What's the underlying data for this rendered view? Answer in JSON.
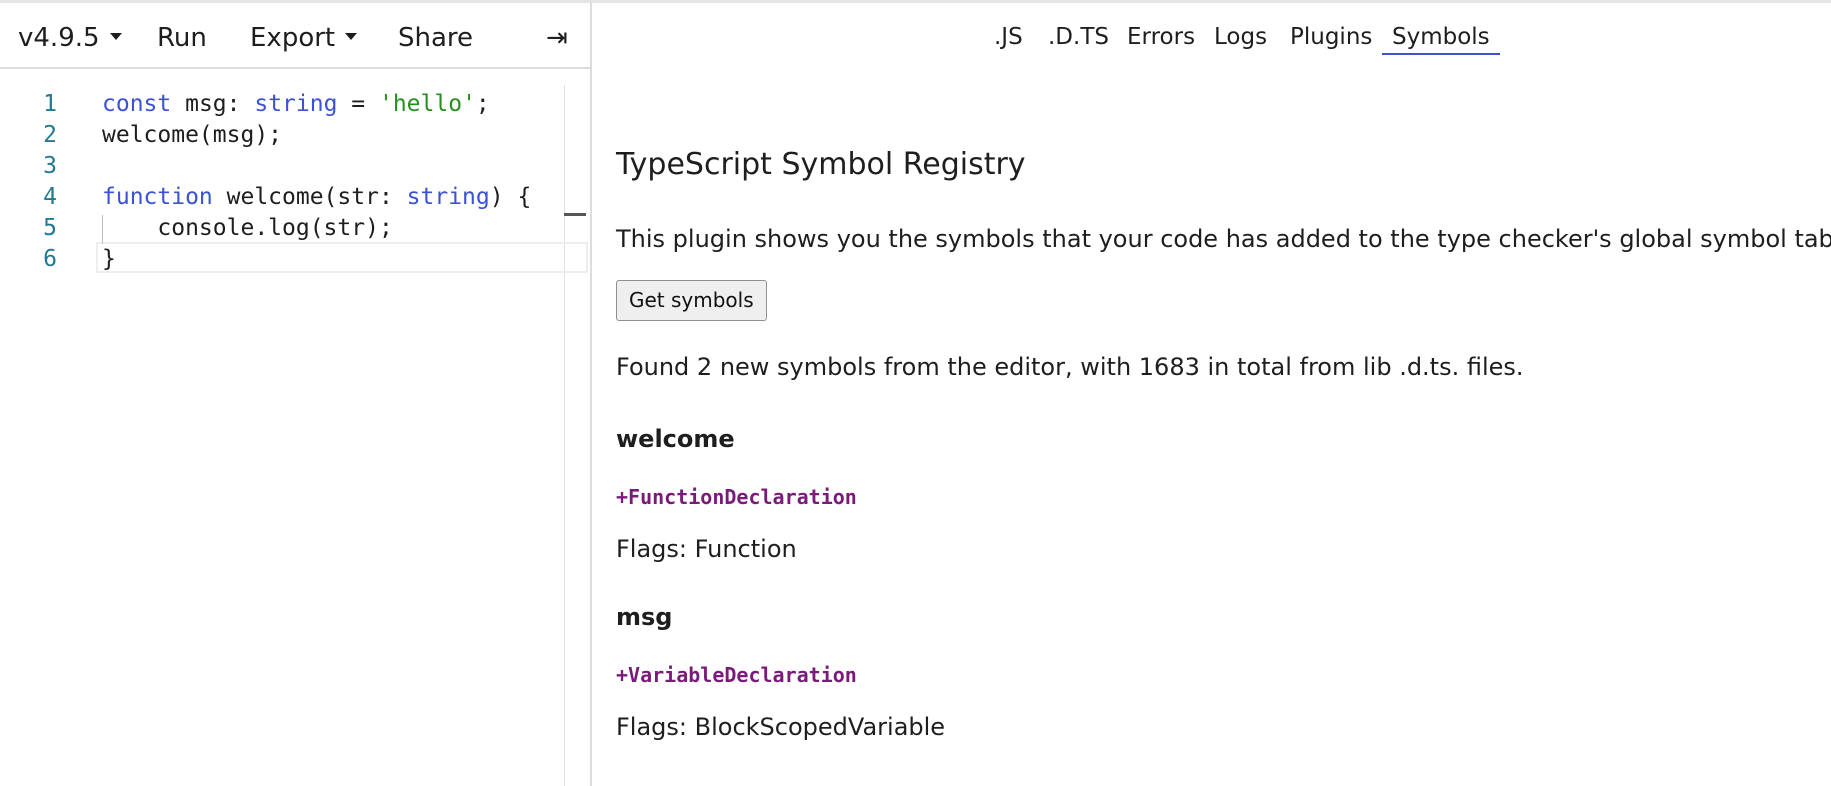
{
  "toolbar": {
    "version": "v4.9.5",
    "run": "Run",
    "export": "Export",
    "share": "Share",
    "collapse": "⇥"
  },
  "editor": {
    "lines": [
      {
        "num": "1",
        "tokens": [
          {
            "t": "const",
            "k": "kw"
          },
          {
            "t": " msg: ",
            "k": ""
          },
          {
            "t": "string",
            "k": "kw"
          },
          {
            "t": " = ",
            "k": ""
          },
          {
            "t": "'hello'",
            "k": "str"
          },
          {
            "t": ";",
            "k": ""
          }
        ]
      },
      {
        "num": "2",
        "tokens": [
          {
            "t": "welcome(msg);",
            "k": ""
          }
        ]
      },
      {
        "num": "3",
        "tokens": []
      },
      {
        "num": "4",
        "tokens": [
          {
            "t": "function",
            "k": "kw"
          },
          {
            "t": " welcome(str: ",
            "k": ""
          },
          {
            "t": "string",
            "k": "kw"
          },
          {
            "t": ") {",
            "k": ""
          }
        ]
      },
      {
        "num": "5",
        "tokens": [
          {
            "t": "    console.log(str);",
            "k": ""
          }
        ]
      },
      {
        "num": "6",
        "tokens": [
          {
            "t": "}",
            "k": ""
          }
        ]
      }
    ]
  },
  "tabs": [
    ".JS",
    ".D.TS",
    "Errors",
    "Logs",
    "Plugins",
    "Symbols"
  ],
  "active_tab": "Symbols",
  "panel": {
    "title": "TypeScript Symbol Registry",
    "description": "This plugin shows you the symbols that your code has added to the type checker's global symbol table.",
    "button": "Get symbols",
    "found": "Found 2 new symbols from the editor, with 1683 in total from lib .d.ts. files.",
    "symbols": [
      {
        "name": "welcome",
        "declaration": "+FunctionDeclaration",
        "flags": "Flags: Function"
      },
      {
        "name": "msg",
        "declaration": "+VariableDeclaration",
        "flags": "Flags: BlockScopedVariable"
      }
    ]
  },
  "colors": {
    "keyword": "#3b52d6",
    "string": "#268f1d",
    "line_number": "#237893",
    "declaration": "#7a1b7a",
    "active_tab_underline": "#3b52d6"
  }
}
